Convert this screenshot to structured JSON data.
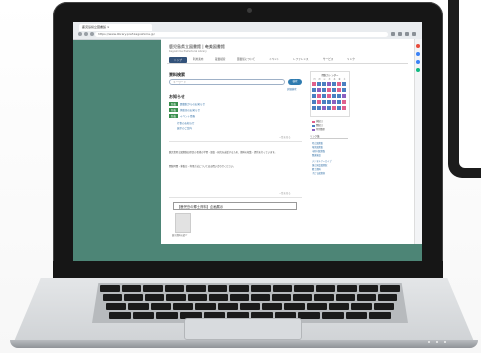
{
  "browser": {
    "tab_title": "鹿児島県立図書館 ×",
    "address": "https://www.library.pref.kagoshima.jp/"
  },
  "site": {
    "title": "鹿児島県立図書館 | 奄美図書館",
    "subtitle": "Kagoshima Prefectural Library",
    "nav": [
      "トップ",
      "利用案内",
      "蔵書検索",
      "図書館について",
      "イベント",
      "レファレンス",
      "サービス",
      "リンク"
    ]
  },
  "search": {
    "heading": "資料検索",
    "placeholder": "キーワード",
    "button": "検索",
    "detail_link": "詳細検索"
  },
  "news": {
    "heading": "お知らせ",
    "items": [
      {
        "tag": "新着",
        "text": "図書館からのお知らせ"
      },
      {
        "tag": "新着",
        "text": "休館日のお知らせ"
      },
      {
        "tag": "新着",
        "text": "イベント情報"
      }
    ],
    "sub_items": [
      "行事のお知らせ",
      "展示のご案内"
    ],
    "more": "一覧を見る"
  },
  "body_text": {
    "p1": "鹿児島県立図書館は県民の皆様の学習・調査・研究を支援するため、資料の収集・提供を行っています。",
    "p2": "開館時間・休館日・利用方法についてはお問い合わせください。",
    "more": "一覧を見る"
  },
  "feature": {
    "heading": "【鹿児島の郷土資料】企画展示",
    "caption": "展示資料の紹介"
  },
  "calendar": {
    "title": "開館カレンダー",
    "weekdays": [
      "日",
      "月",
      "火",
      "水",
      "木",
      "金",
      "土"
    ],
    "legend": [
      "休館日",
      "開館日",
      "特別整理"
    ]
  },
  "links": {
    "heading": "リンク集",
    "items": [
      "県立図書館",
      "奄美図書館",
      "市町村図書館",
      "関連施設",
      "デジタルアーカイブ",
      "国立国会図書館",
      "郷土資料",
      "子ども図書室"
    ]
  },
  "colors": {
    "screen_bg": "#4d8576",
    "accent": "#2e7bb0",
    "nav_active": "#33527a",
    "holiday": "#e0608c",
    "open_day": "#4a7fc1",
    "special": "#8b5fbf"
  }
}
